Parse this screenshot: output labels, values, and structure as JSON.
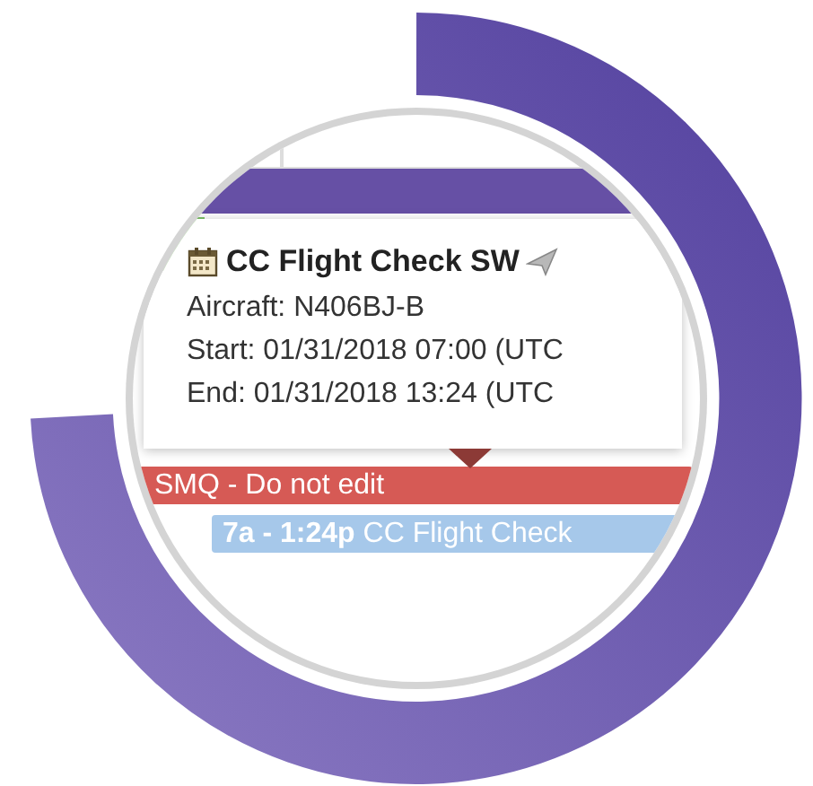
{
  "events": [
    {
      "title": "SMQ - Do not edit",
      "color": "#d65a55"
    },
    {
      "time": "7a - 1:24p",
      "title": "CC Flight Check",
      "color": "#a6c8ea"
    }
  ],
  "tooltip": {
    "title": "CC Flight Check SW",
    "lines": [
      "Aircraft: N406BJ-B",
      "Start: 01/31/2018 07:00 (UTC",
      "End: 01/31/2018 13:24 (UTC"
    ]
  }
}
